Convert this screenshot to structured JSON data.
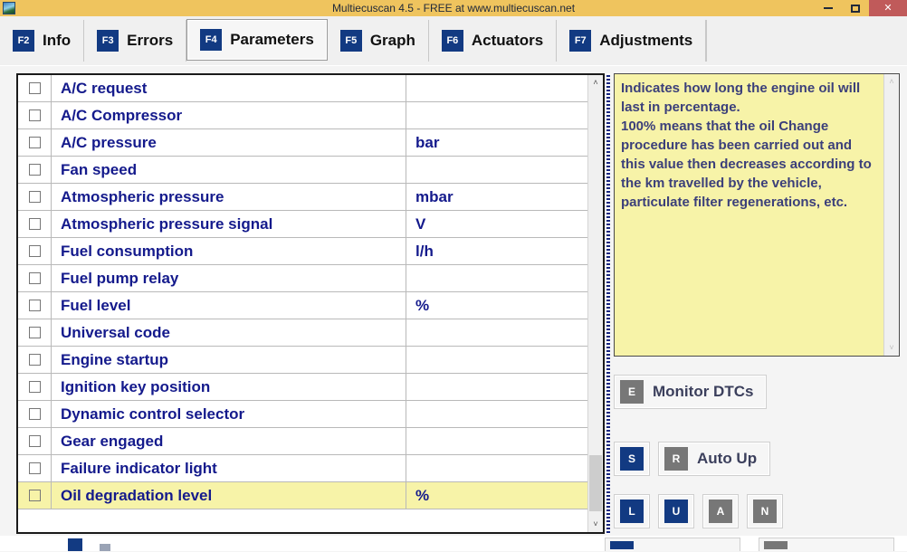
{
  "window": {
    "title": "Multiecuscan 4.5 - FREE at www.multiecuscan.net",
    "app_icon": "app-icon",
    "controls": {
      "minimize": "minimize-icon",
      "maximize": "maximize-icon",
      "close": "✕"
    }
  },
  "tabs": [
    {
      "fkey": "F2",
      "label": "Info",
      "active": false
    },
    {
      "fkey": "F3",
      "label": "Errors",
      "active": false
    },
    {
      "fkey": "F4",
      "label": "Parameters",
      "active": true
    },
    {
      "fkey": "F5",
      "label": "Graph",
      "active": false
    },
    {
      "fkey": "F6",
      "label": "Actuators",
      "active": false
    },
    {
      "fkey": "F7",
      "label": "Adjustments",
      "active": false
    }
  ],
  "parameters": {
    "rows": [
      {
        "checked": false,
        "name": "A/C request",
        "unit": "",
        "selected": false
      },
      {
        "checked": false,
        "name": "A/C Compressor",
        "unit": "",
        "selected": false
      },
      {
        "checked": false,
        "name": "A/C pressure",
        "unit": "bar",
        "selected": false
      },
      {
        "checked": false,
        "name": "Fan speed",
        "unit": "",
        "selected": false
      },
      {
        "checked": false,
        "name": "Atmospheric pressure",
        "unit": "mbar",
        "selected": false
      },
      {
        "checked": false,
        "name": "Atmospheric pressure signal",
        "unit": "V",
        "selected": false
      },
      {
        "checked": false,
        "name": "Fuel consumption",
        "unit": "l/h",
        "selected": false
      },
      {
        "checked": false,
        "name": "Fuel pump relay",
        "unit": "",
        "selected": false
      },
      {
        "checked": false,
        "name": "Fuel level",
        "unit": "%",
        "selected": false
      },
      {
        "checked": false,
        "name": "Universal code",
        "unit": "",
        "selected": false
      },
      {
        "checked": false,
        "name": "Engine startup",
        "unit": "",
        "selected": false
      },
      {
        "checked": false,
        "name": "Ignition key position",
        "unit": "",
        "selected": false
      },
      {
        "checked": false,
        "name": "Dynamic control selector",
        "unit": "",
        "selected": false
      },
      {
        "checked": false,
        "name": "Gear engaged",
        "unit": "",
        "selected": false
      },
      {
        "checked": false,
        "name": "Failure indicator light",
        "unit": "",
        "selected": false
      },
      {
        "checked": false,
        "name": "Oil degradation level",
        "unit": "%",
        "selected": true
      }
    ],
    "scrollbar": {
      "up_arrow": "˄",
      "down_arrow": "˅"
    }
  },
  "description_panel": {
    "text": "Indicates how long the engine oil will last in percentage.\n100% means that the oil Change procedure has been carried out and this value then decreases according to the km travelled by the vehicle, particulate filter regenerations, etc.",
    "scrollbar": {
      "up_arrow": "˄",
      "down_arrow": "˅"
    }
  },
  "actions": {
    "monitor_dtcs": {
      "key": "E",
      "key_color": "gray",
      "label": "Monitor DTCs"
    },
    "stop": {
      "key": "S",
      "key_color": "blue",
      "label": ""
    },
    "auto_up": {
      "key": "R",
      "key_color": "gray",
      "label": "Auto Up"
    },
    "load": {
      "key": "L",
      "key_color": "blue",
      "label": ""
    },
    "unit": {
      "key": "U",
      "key_color": "blue",
      "label": ""
    },
    "all": {
      "key": "A",
      "key_color": "gray",
      "label": ""
    },
    "none": {
      "key": "N",
      "key_color": "gray",
      "label": ""
    }
  },
  "colors": {
    "titlebar": "#efc45e",
    "close_button": "#c05a5a",
    "fkey_badge": "#123a82",
    "param_text": "#141a8c",
    "selected_row": "#f7f3a8",
    "tooltip_bg": "#f7f3a8",
    "tooltip_text": "#3b3f7a",
    "key_gray": "#777777"
  }
}
